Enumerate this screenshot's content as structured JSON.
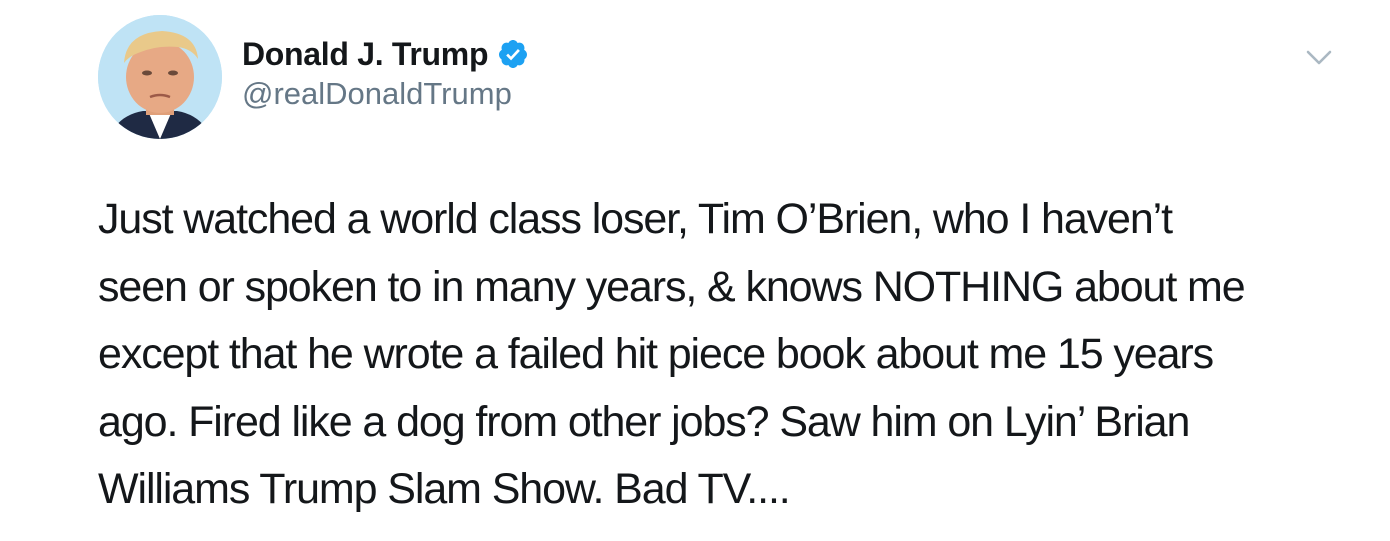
{
  "author": {
    "display_name": "Donald J. Trump",
    "handle": "@realDonaldTrump",
    "verified": true
  },
  "icons": {
    "verified_badge": "verified-badge-icon",
    "more_menu": "chevron-down-icon"
  },
  "colors": {
    "verified_blue": "#1da1f2",
    "handle_gray": "#657786",
    "text": "#14171a",
    "caret_gray": "#aab8c2"
  },
  "tweet": {
    "lines": [
      "Just watched a world class loser, Tim O’Brien, who I haven’t",
      "seen or spoken to in many years, & knows NOTHING about me",
      "except that he wrote a failed hit piece book about me 15 years",
      "ago. Fired like a dog from other jobs? Saw him on Lyin’ Brian",
      "Williams Trump Slam Show. Bad TV...."
    ]
  }
}
